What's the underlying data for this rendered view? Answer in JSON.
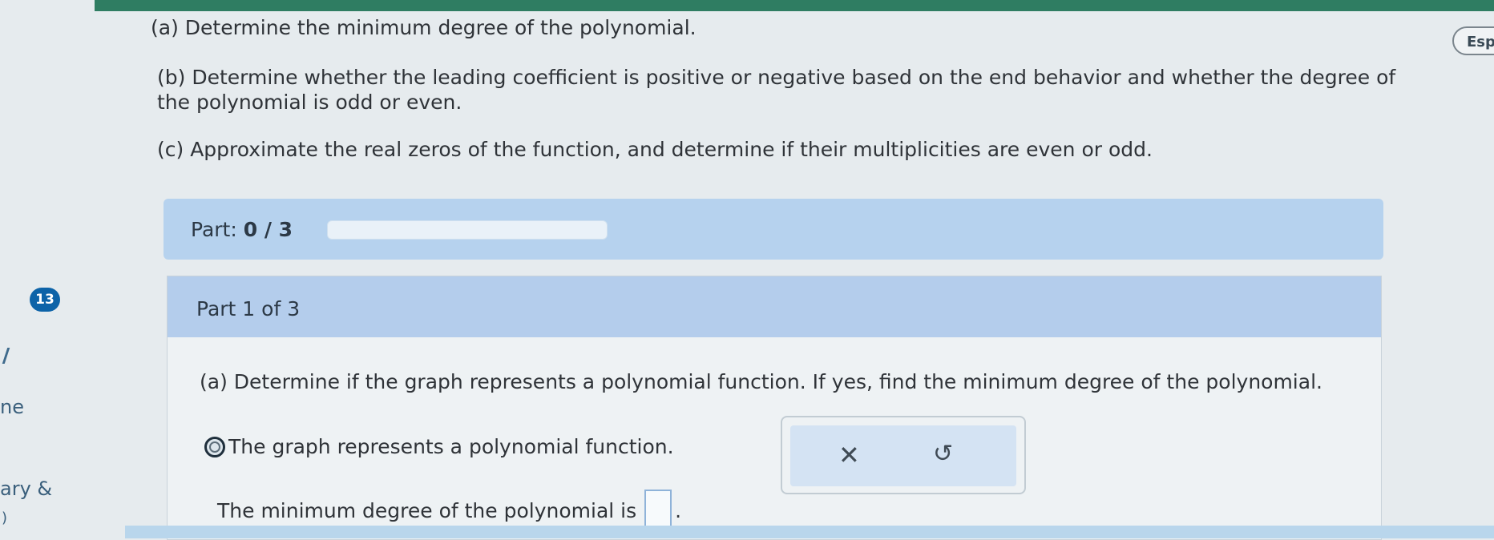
{
  "sidebar": {
    "badge": "13",
    "item_1": "ne",
    "item_2": "ary &",
    "item_3": ")"
  },
  "language_button": "Espa",
  "intro": {
    "a": "(a) Determine the minimum degree of the polynomial.",
    "b1": "(b) Determine whether the leading coefficient is positive or negative based on the end behavior and whether the degree of",
    "b2": "the polynomial is odd or even.",
    "c": "(c) Approximate the real zeros of the function, and determine if their multiplicities are even or odd."
  },
  "progress": {
    "label": "Part:",
    "value": "0 / 3",
    "fraction": 0
  },
  "part": {
    "title": "Part 1 of 3",
    "question": "(a) Determine if the graph represents a polynomial function. If yes, find the minimum degree of the polynomial.",
    "option_label": "The graph represents a polynomial function.",
    "min_degree_label": "The minimum degree of the polynomial is",
    "min_degree_value": "",
    "period": "."
  },
  "tools": {
    "clear_icon": "✕",
    "undo_icon": "↺"
  },
  "colors": {
    "accent": "#2f7d62",
    "badge": "#0d63a8",
    "header": "#b4cdec"
  }
}
